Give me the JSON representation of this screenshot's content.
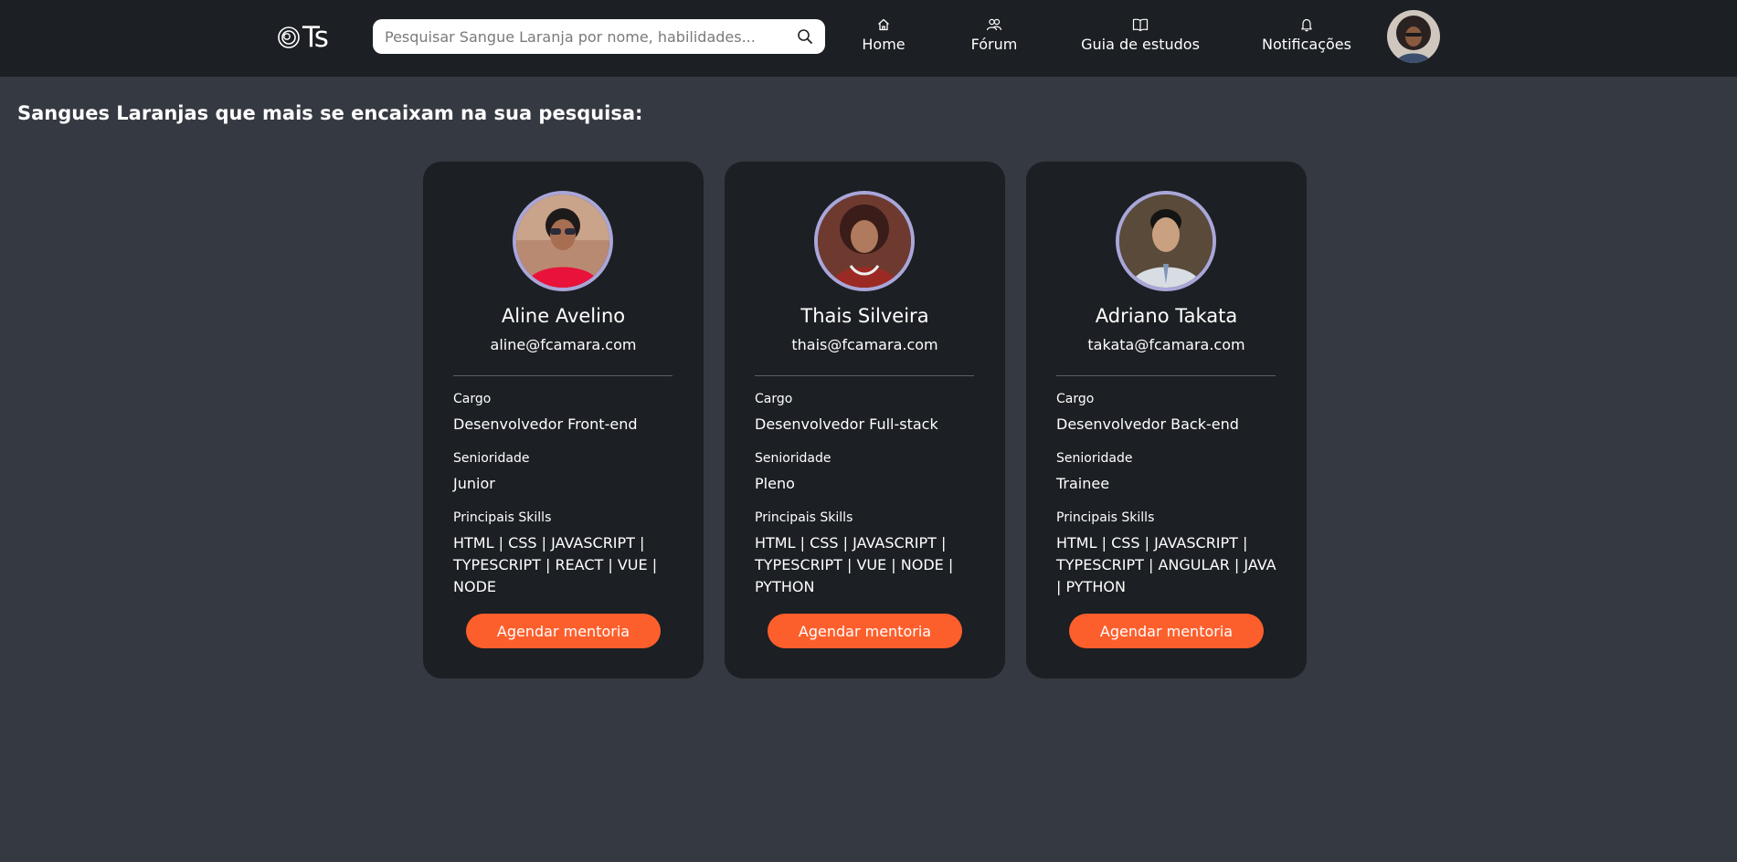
{
  "header": {
    "logo_text": "Ts",
    "search_placeholder": "Pesquisar Sangue Laranja por nome, habilidades...",
    "nav": [
      {
        "label": "Home",
        "icon": "home-icon"
      },
      {
        "label": "Fórum",
        "icon": "users-icon"
      },
      {
        "label": "Guia de estudos",
        "icon": "book-icon"
      },
      {
        "label": "Notificações",
        "icon": "bell-icon"
      }
    ]
  },
  "main": {
    "title": "Sangues Laranjas que mais se encaixam na sua pesquisa:",
    "field_labels": {
      "cargo": "Cargo",
      "senioridade": "Senioridade",
      "skills": "Principais Skills"
    },
    "button_label": "Agendar mentoria",
    "cards": [
      {
        "name": "Aline Avelino",
        "email": "aline@fcamara.com",
        "cargo": "Desenvolvedor Front-end",
        "senioridade": "Junior",
        "skills": "HTML | CSS | JAVASCRIPT | TYPESCRIPT | REACT | VUE | NODE"
      },
      {
        "name": "Thais Silveira",
        "email": "thais@fcamara.com",
        "cargo": "Desenvolvedor Full-stack",
        "senioridade": "Pleno",
        "skills": "HTML | CSS | JAVASCRIPT | TYPESCRIPT | VUE | NODE | PYTHON"
      },
      {
        "name": "Adriano Takata",
        "email": "takata@fcamara.com",
        "cargo": "Desenvolvedor Back-end",
        "senioridade": "Trainee",
        "skills": "HTML | CSS | JAVASCRIPT | TYPESCRIPT | ANGULAR | JAVA | PYTHON"
      }
    ]
  },
  "colors": {
    "page_bg": "#353941",
    "bar_bg": "#1c1f23",
    "card_bg": "#1c1f23",
    "accent": "#fd5f2c",
    "avatar_ring": "#a9a6d9"
  }
}
